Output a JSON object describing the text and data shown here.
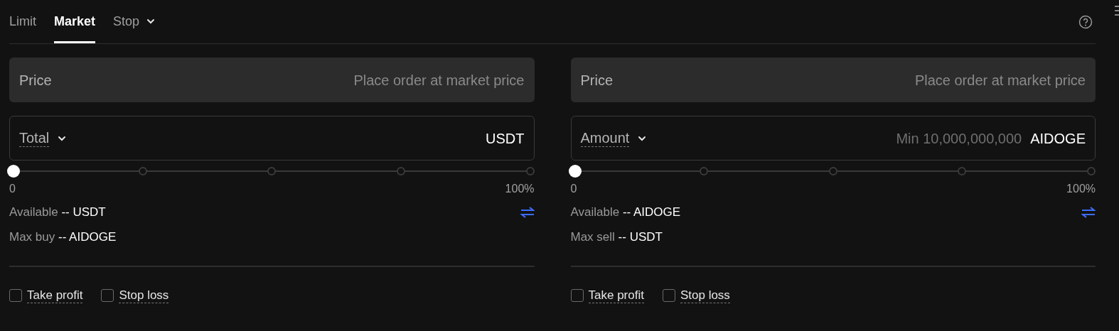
{
  "tabs": [
    {
      "label": "Limit",
      "selected": false,
      "dropdown": false
    },
    {
      "label": "Market",
      "selected": true,
      "dropdown": false
    },
    {
      "label": "Stop",
      "selected": false,
      "dropdown": true
    }
  ],
  "panels": [
    {
      "price": {
        "label": "Price",
        "placeholder": "Place order at market price"
      },
      "amount": {
        "label": "Total",
        "unit": "USDT"
      },
      "slider": {
        "level": 0,
        "min_label": "0",
        "max_label": "100%"
      },
      "available": {
        "label": "Available",
        "value": "-- USDT"
      },
      "max": {
        "label": "Max buy",
        "value": "-- AIDOGE"
      },
      "options": [
        {
          "label": "Take profit",
          "checked": false
        },
        {
          "label": "Stop loss",
          "checked": false
        }
      ]
    },
    {
      "price": {
        "label": "Price",
        "placeholder": "Place order at market price"
      },
      "amount": {
        "label": "Amount",
        "placeholder": "Min 10,000,000,000",
        "unit": "AIDOGE"
      },
      "slider": {
        "level": 0,
        "min_label": "0",
        "max_label": "100%"
      },
      "available": {
        "label": "Available",
        "value": "-- AIDOGE"
      },
      "max": {
        "label": "Max sell",
        "value": "-- USDT"
      },
      "options": [
        {
          "label": "Take profit",
          "checked": false
        },
        {
          "label": "Stop loss",
          "checked": false
        }
      ]
    }
  ]
}
